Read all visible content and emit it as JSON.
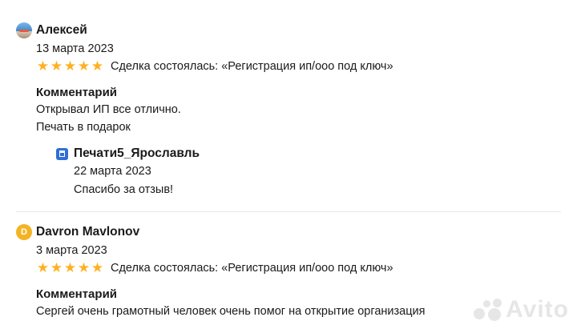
{
  "reviews": [
    {
      "author": "Алексей",
      "avatar": {
        "type": "photo"
      },
      "date": "13 марта 2023",
      "rating": 5,
      "deal": "Сделка состоялась: «Регистрация ип/ооо под ключ»",
      "comment_label": "Комментарий",
      "comment_lines": [
        "Открывал ИП все отлично.",
        "Печать в подарок"
      ],
      "reply": {
        "author": "Печати5_Ярославль",
        "icon": "shop-icon",
        "date": "22 марта 2023",
        "text": "Спасибо за отзыв!"
      }
    },
    {
      "author": "Davron Mavlonov",
      "avatar": {
        "type": "letter",
        "letter": "D"
      },
      "date": "3 марта 2023",
      "rating": 5,
      "deal": "Сделка состоялась: «Регистрация ип/ооо под ключ»",
      "comment_label": "Комментарий",
      "comment_lines": [
        "Сергей очень грамотный человек очень помог на открытие организация"
      ]
    }
  ],
  "watermark": {
    "text": "Avito"
  },
  "colors": {
    "star": "#ffb021",
    "letter_avatar": "#f4b324",
    "shop_icon": "#2f6fd6"
  }
}
